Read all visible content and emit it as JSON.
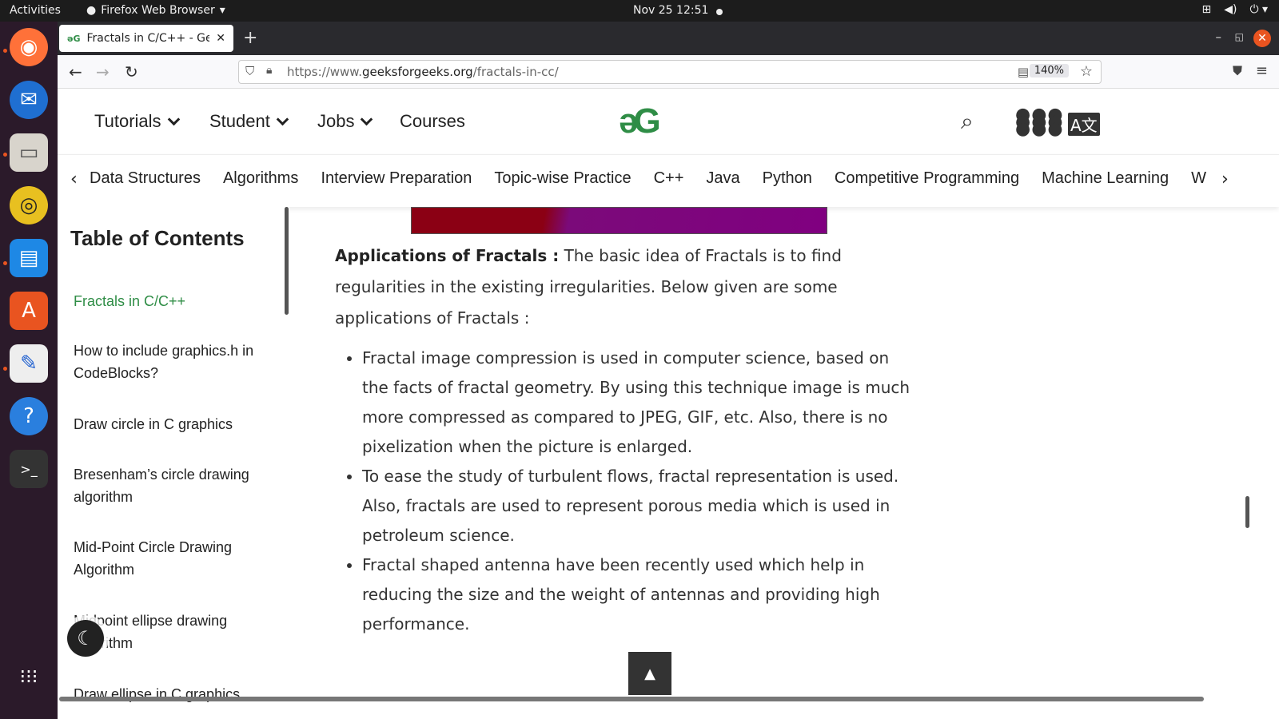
{
  "system": {
    "activities": "Activities",
    "app_name": "Firefox Web Browser",
    "datetime": "Nov 25  12:51"
  },
  "browser": {
    "tab_title": "Fractals in C/C++ - GeeksforGeeks",
    "url_prefix": "https://www.",
    "url_domain": "geeksforgeeks.org",
    "url_path": "/fractals-in-cc/",
    "zoom": "140%"
  },
  "site": {
    "logo": "əG",
    "nav": [
      {
        "label": "Tutorials"
      },
      {
        "label": "Student"
      },
      {
        "label": "Jobs"
      },
      {
        "label": "Courses"
      }
    ],
    "subnav": [
      "Data Structures",
      "Algorithms",
      "Interview Preparation",
      "Topic-wise Practice",
      "C++",
      "Java",
      "Python",
      "Competitive Programming",
      "Machine Learning",
      "W"
    ]
  },
  "toc": {
    "title": "Table of Contents",
    "entries": [
      "Fractals in C/C++",
      "How to include graphics.h in CodeBlocks?",
      "Draw circle in C graphics",
      "Bresenham’s circle drawing algorithm",
      "Mid-Point Circle Drawing Algorithm",
      "Midpoint ellipse drawing algorithm",
      "Draw ellipse in C graphics"
    ]
  },
  "article": {
    "heading": "Applications of Fractals :",
    "intro": " The basic idea of Fractals is to find regularities in the existing irregularities. Below given are some applications of Fractals :",
    "bullets": [
      "Fractal image compression is used in computer science, based on the facts of fractal geometry. By using this technique image is much more compressed as compared to JPEG, GIF, etc. Also, there is no pixelization when the picture is enlarged.",
      "To ease the study of turbulent flows, fractal representation is used. Also, fractals are used to represent porous media which is used in petroleum science.",
      "Fractal shaped antenna have been recently used which help in reducing the size and the weight of antennas and providing high performance."
    ]
  },
  "icons": {
    "back": "back-arrow-icon",
    "forward": "forward-arrow-icon",
    "reload": "reload-icon",
    "search": "search-icon",
    "apps": "apps-grid-icon",
    "translate": "translate-icon",
    "dark_mode": "moon-icon",
    "scroll_top": "up-arrow-icon"
  },
  "colors": {
    "brand_green": "#2f8d46",
    "ubuntu_orange": "#e95420"
  }
}
